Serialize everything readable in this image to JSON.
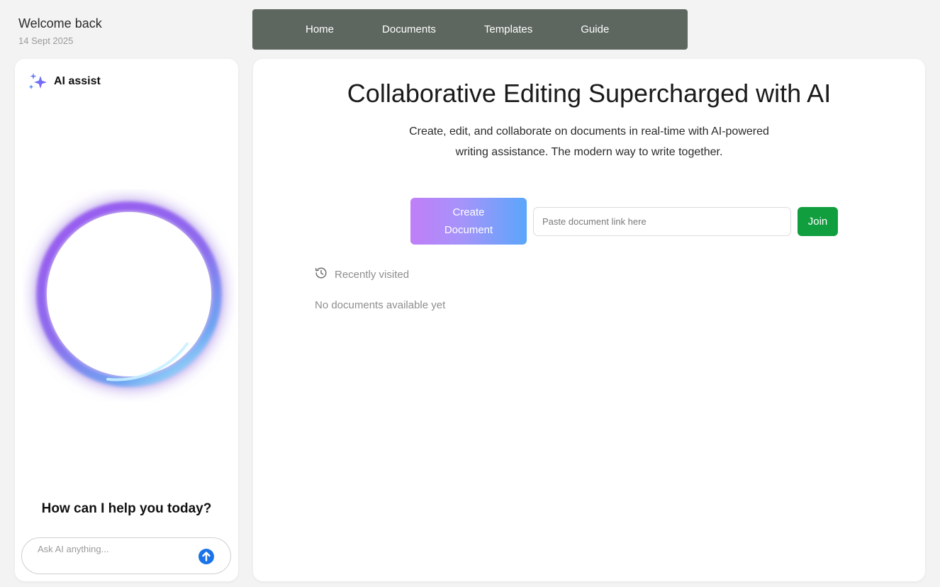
{
  "header": {
    "title": "Welcome back",
    "date": "14 Sept 2025"
  },
  "nav": {
    "items": [
      {
        "label": "Home",
        "name": "nav-home"
      },
      {
        "label": "Documents",
        "name": "nav-documents"
      },
      {
        "label": "Templates",
        "name": "nav-templates"
      },
      {
        "label": "Guide",
        "name": "nav-guide"
      }
    ],
    "background": "#5e675f"
  },
  "sidebar": {
    "title": "AI assist",
    "icon": "sparkles-icon",
    "prompt_heading": "How can I help you today?",
    "input_placeholder": "Ask AI anything...",
    "send_icon": "arrow-up-icon",
    "send_color": "#1a73e8"
  },
  "main": {
    "title": "Collaborative Editing Supercharged with AI",
    "subtitle": "Create, edit, and collaborate on documents in real-time with AI-powered writing assistance. The modern way to write together.",
    "create_button": {
      "line1": "Create",
      "line2": "Document"
    },
    "link_placeholder": "Paste document link here",
    "join_label": "Join",
    "join_color": "#119e3e",
    "recent": {
      "icon": "history-icon",
      "label": "Recently visited",
      "empty_message": "No documents available yet"
    }
  }
}
